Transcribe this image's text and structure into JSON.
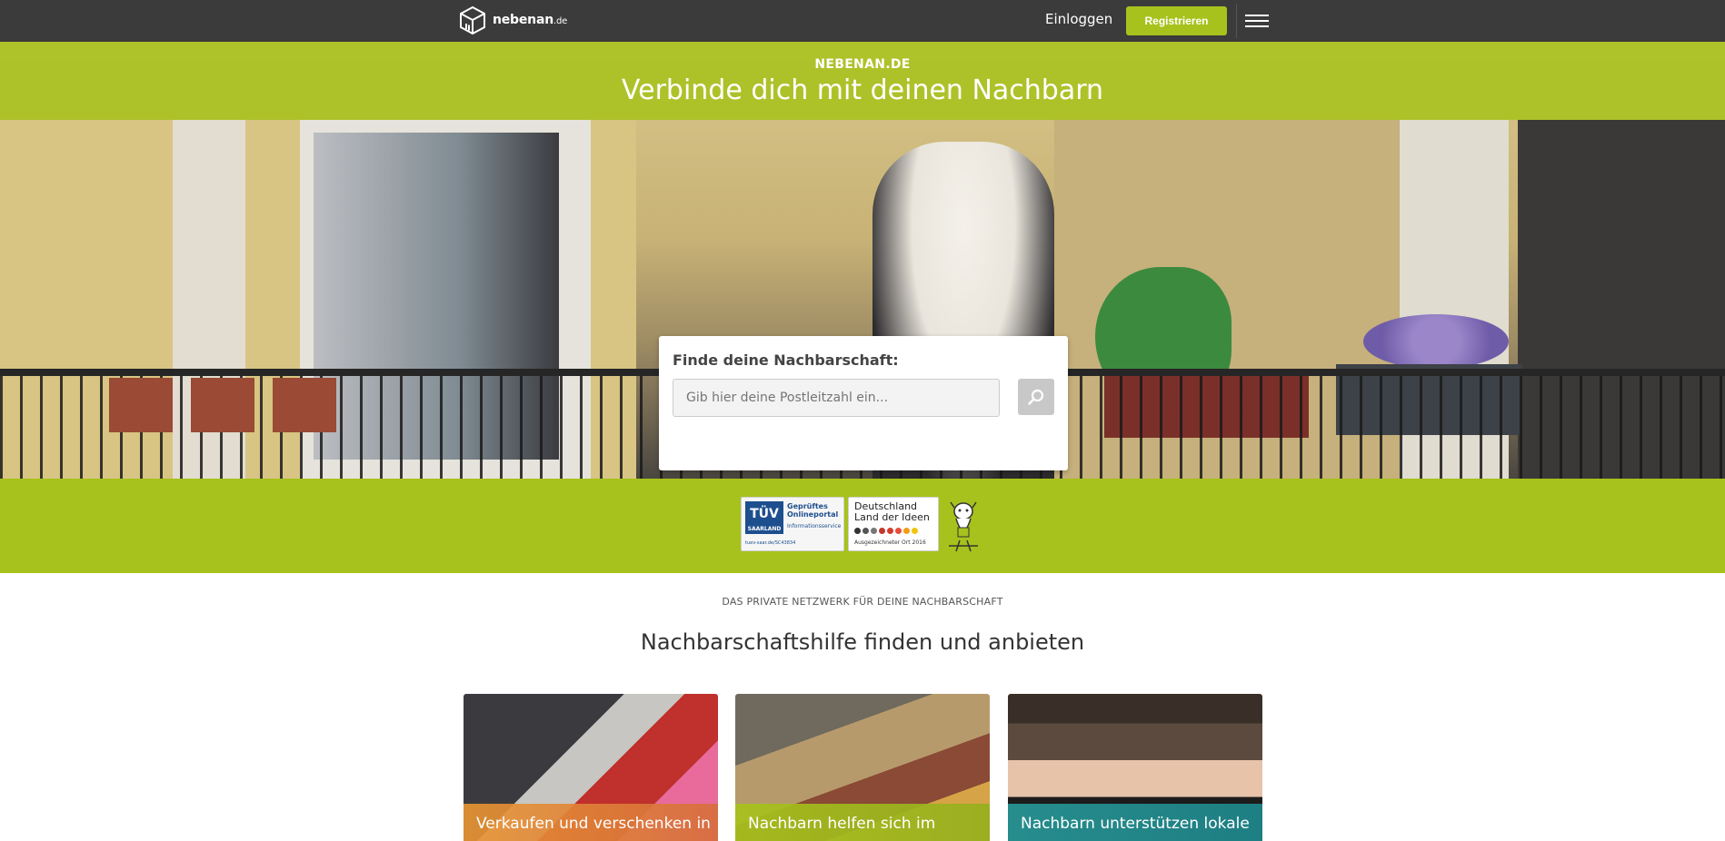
{
  "header": {
    "logo_text": "nebenan",
    "logo_suffix": ".de",
    "login_label": "Einloggen",
    "register_label": "Registrieren"
  },
  "hero": {
    "eyebrow": "NEBENAN.DE",
    "title": "Verbinde dich mit deinen Nachbarn",
    "search_label": "Finde deine Nachbarschaft:",
    "search_placeholder": "Gib hier deine Postleitzahl ein...",
    "slides": 3,
    "active_slide": 1
  },
  "badges": {
    "tuv_logo": "TÜV",
    "tuv_sub": "SAARLAND",
    "tuv_title": "Geprüftes Onlineportal",
    "tuv_detail": "Informationsservice",
    "tuv_url": "tuev-saar.de/SC43834",
    "dli_title": "Deutschland Land der Ideen",
    "dli_foot": "Ausgezeichneter Ort 2016"
  },
  "content": {
    "eyebrow": "DAS PRIVATE NETZWERK FÜR DEINE NACHBARSCHAFT",
    "title": "Nachbarschaftshilfe finden und anbieten",
    "cards": [
      {
        "caption": "Verkaufen und verschenken in"
      },
      {
        "caption": "Nachbarn helfen sich im"
      },
      {
        "caption": "Nachbarn unterstützen lokale"
      }
    ]
  },
  "colors": {
    "brand": "#a7c21c",
    "nav": "#3b3b3b"
  }
}
